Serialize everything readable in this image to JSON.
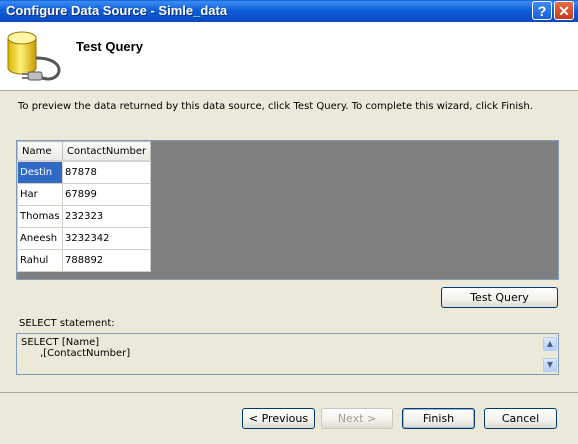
{
  "window": {
    "title": "Configure Data Source - Simle_data",
    "help_label": "?",
    "close_label": "✕"
  },
  "header": {
    "title": "Test Query",
    "icon": "database-plug-icon"
  },
  "instructions": "To preview the data returned by this data source, click Test Query. To complete this wizard, click Finish.",
  "grid": {
    "columns": [
      "Name",
      "ContactNumber"
    ],
    "rows": [
      [
        "Destin",
        "87878"
      ],
      [
        "Har",
        "67899"
      ],
      [
        "Thomas",
        "232323"
      ],
      [
        "Aneesh",
        "3232342"
      ],
      [
        "Rahul",
        "788892"
      ]
    ],
    "selected_row": 0
  },
  "buttons": {
    "test_query": "Test Query",
    "previous": "< Previous",
    "next": "Next >",
    "finish": "Finish",
    "cancel": "Cancel"
  },
  "select_statement": {
    "label": "SELECT statement:",
    "line1": "SELECT [Name]",
    "line2": "      ,[ContactNumber]"
  },
  "colors": {
    "titlebar": "#0a50c8",
    "selection": "#316ac5",
    "dialog_bg": "#ece9d8"
  }
}
